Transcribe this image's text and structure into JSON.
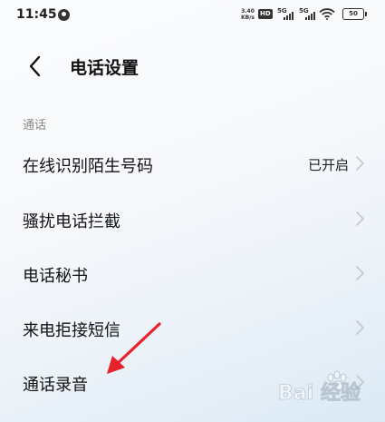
{
  "status_bar": {
    "time": "11:45",
    "speed_value": "3.40",
    "speed_unit": "KB/s",
    "hd_label": "HD",
    "net1": "5G",
    "net2": "5G",
    "battery": "50"
  },
  "header": {
    "title": "电话设置",
    "back_icon": "chevron-left-icon"
  },
  "section": {
    "label": "通话"
  },
  "rows": [
    {
      "label": "在线识别陌生号码",
      "value": "已开启"
    },
    {
      "label": "骚扰电话拦截",
      "value": ""
    },
    {
      "label": "电话秘书",
      "value": ""
    },
    {
      "label": "来电拒接短信",
      "value": ""
    },
    {
      "label": "通话录音",
      "value": ""
    }
  ],
  "annotation": {
    "color": "#e8222d"
  },
  "watermark": {
    "text": "Bai 经验"
  }
}
